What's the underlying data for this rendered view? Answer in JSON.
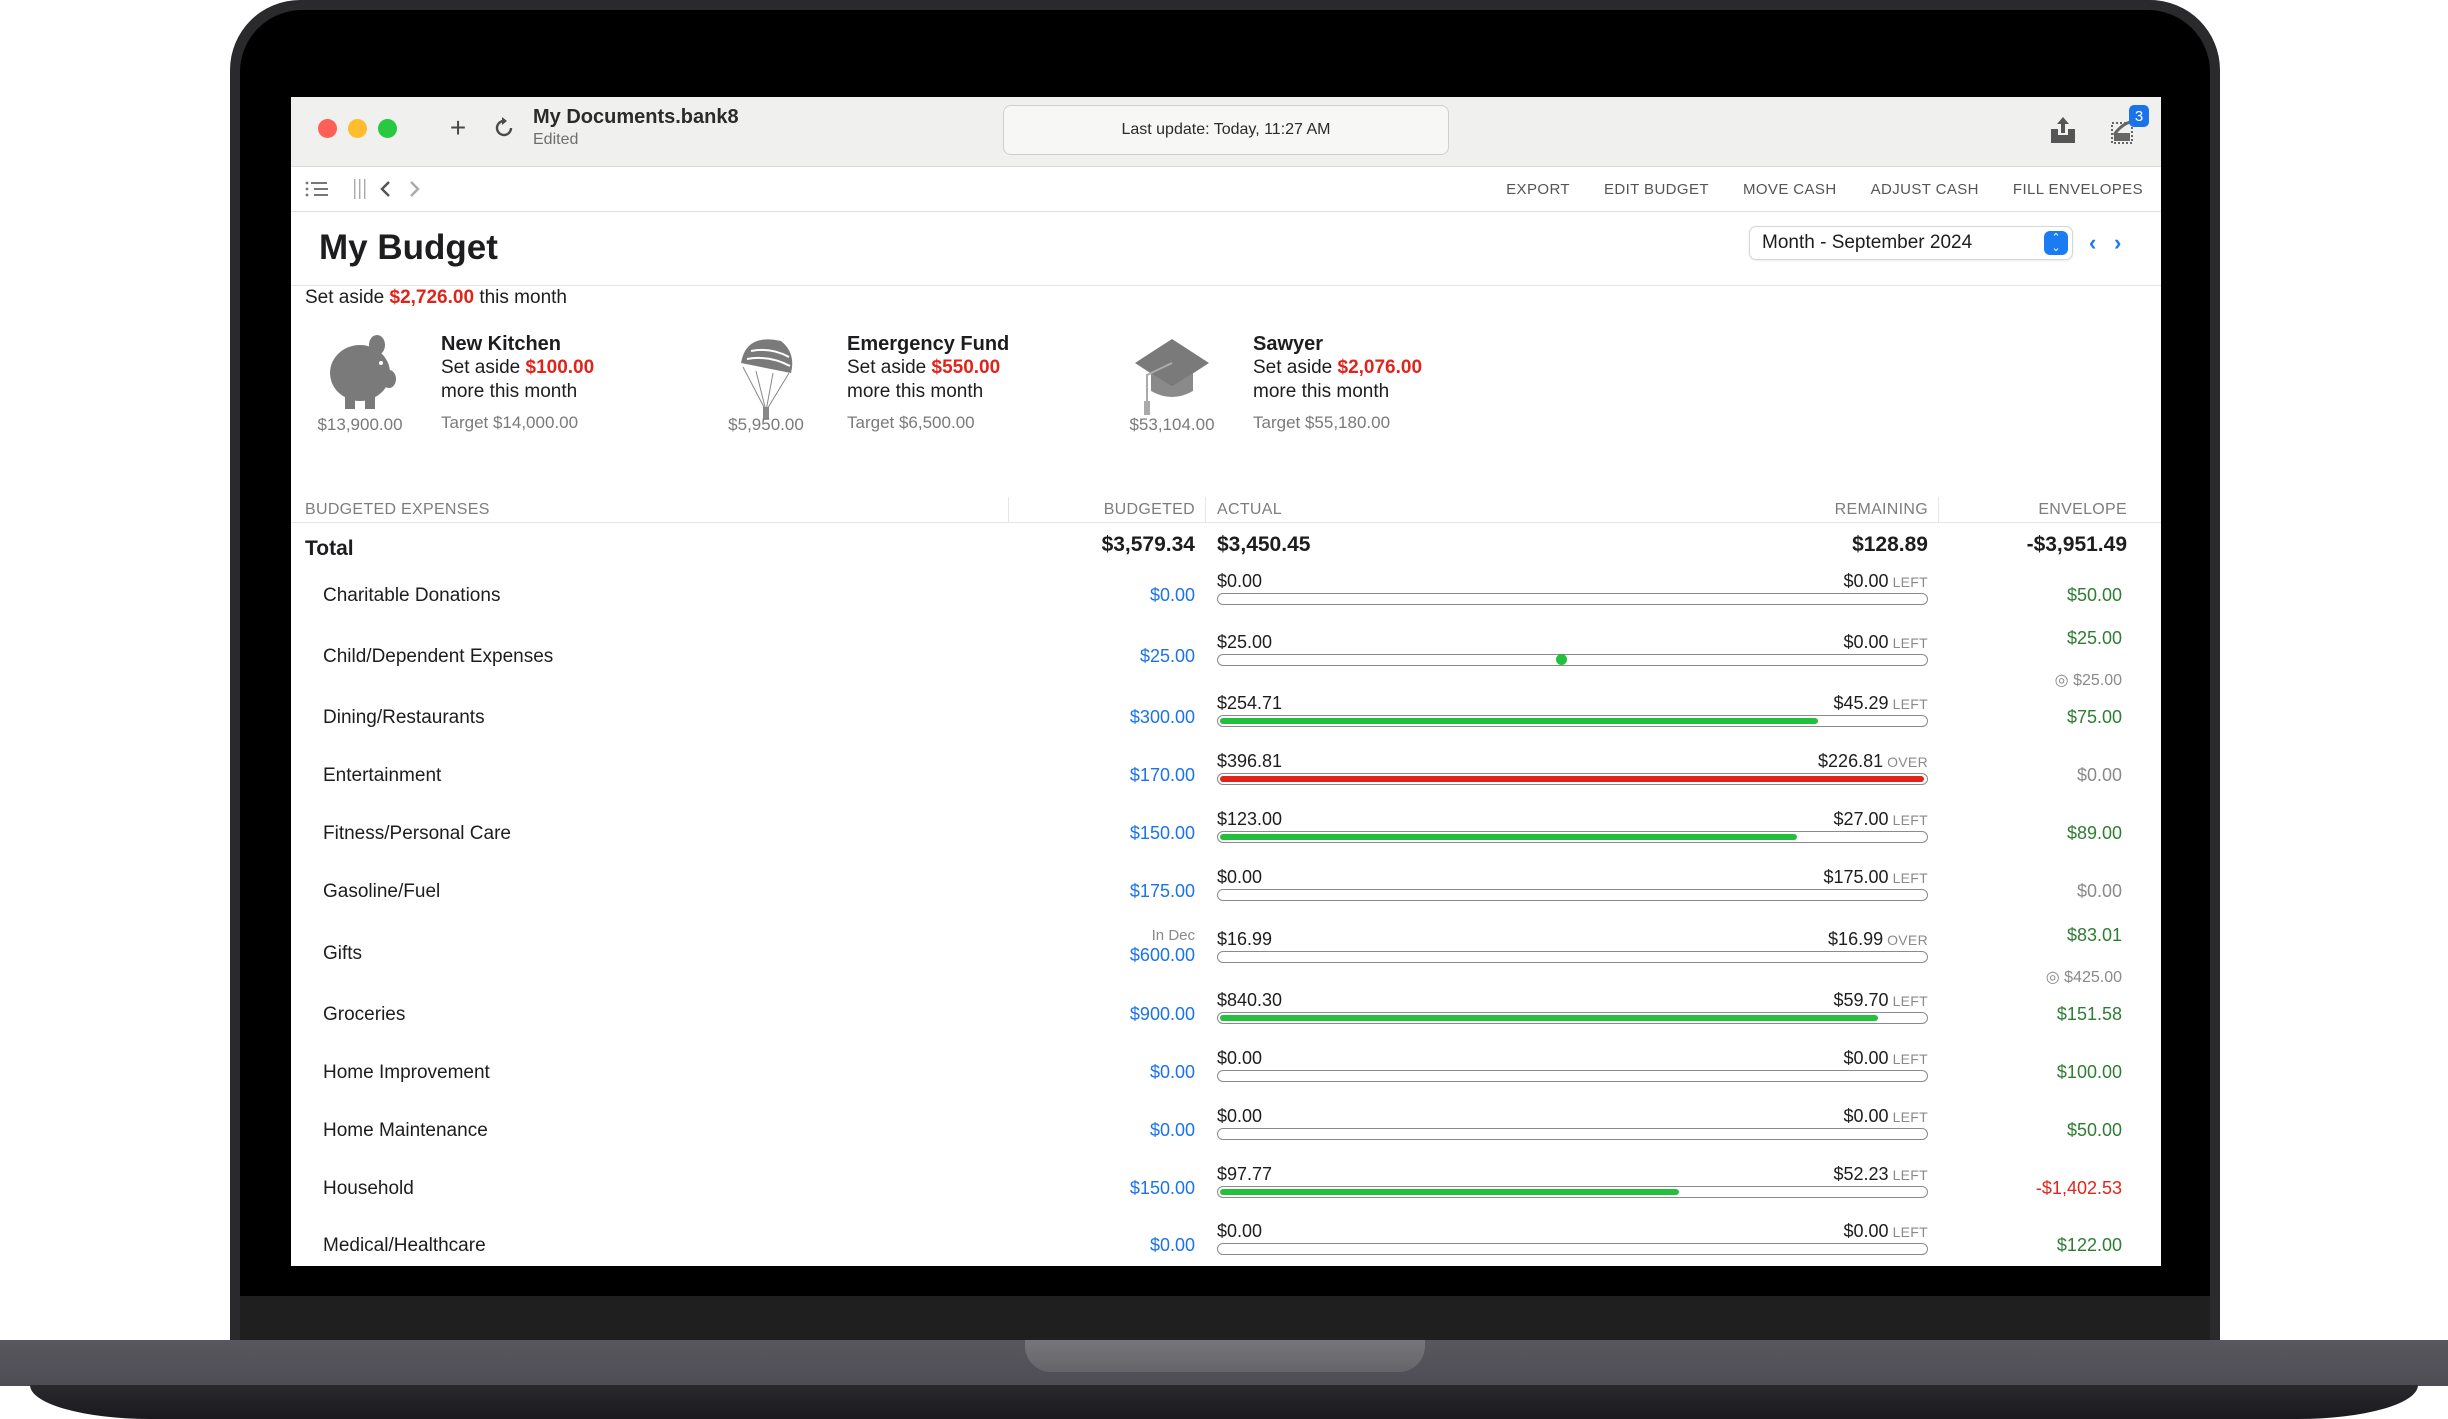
{
  "window": {
    "document_title": "My Documents.bank8",
    "document_status": "Edited",
    "status_message": "Last update: Today, 11:27 AM",
    "notification_count": "3"
  },
  "toolbar": {
    "actions": [
      "EXPORT",
      "EDIT BUDGET",
      "MOVE CASH",
      "ADJUST CASH",
      "FILL ENVELOPES"
    ]
  },
  "page": {
    "title": "My Budget",
    "period": "Month - September 2024",
    "set_aside_prefix": "Set aside",
    "set_aside_amount": "$2,726.00",
    "set_aside_suffix": "this month"
  },
  "goals": [
    {
      "icon": "piggy-bank-icon",
      "name": "New Kitchen",
      "balance": "$13,900.00",
      "set_aside_prefix": "Set aside",
      "set_aside_amount": "$100.00",
      "more": "more this month",
      "target": "Target $14,000.00"
    },
    {
      "icon": "parachute-icon",
      "name": "Emergency Fund",
      "balance": "$5,950.00",
      "set_aside_prefix": "Set aside",
      "set_aside_amount": "$550.00",
      "more": "more this month",
      "target": "Target $6,500.00"
    },
    {
      "icon": "graduation-cap-icon",
      "name": "Sawyer",
      "balance": "$53,104.00",
      "set_aside_prefix": "Set aside",
      "set_aside_amount": "$2,076.00",
      "more": "more this month",
      "target": "Target $55,180.00"
    }
  ],
  "table": {
    "headers": {
      "category": "BUDGETED EXPENSES",
      "budgeted": "BUDGETED",
      "actual": "ACTUAL",
      "remaining": "REMAINING",
      "envelope": "ENVELOPE"
    },
    "total": {
      "label": "Total",
      "budgeted": "$3,579.34",
      "actual": "$3,450.45",
      "remaining": "$128.89",
      "envelope": "-$3,951.49"
    },
    "rows": [
      {
        "name": "Charitable Donations",
        "budgeted": "$0.00",
        "actual": "$0.00",
        "remaining": "$0.00",
        "status": "LEFT",
        "progress": 0,
        "bar": "empty",
        "envelope": "$50.00",
        "envelope_color": "#2e7d32"
      },
      {
        "name": "Child/Dependent Expenses",
        "budgeted": "$25.00",
        "actual": "$25.00",
        "remaining": "$0.00",
        "status": "LEFT",
        "progress": 0.48,
        "bar": "dot",
        "envelope": "$25.00",
        "envelope_color": "#2e7d32",
        "envelope_goal": "◎ $25.00"
      },
      {
        "name": "Dining/Restaurants",
        "budgeted": "$300.00",
        "actual": "$254.71",
        "remaining": "$45.29",
        "status": "LEFT",
        "progress": 0.849,
        "bar": "green",
        "envelope": "$75.00",
        "envelope_color": "#2e7d32"
      },
      {
        "name": "Entertainment",
        "budgeted": "$170.00",
        "actual": "$396.81",
        "remaining": "$226.81",
        "status": "OVER",
        "progress": 1,
        "bar": "red",
        "envelope": "$0.00",
        "envelope_color": "#8a8a8a"
      },
      {
        "name": "Fitness/Personal Care",
        "budgeted": "$150.00",
        "actual": "$123.00",
        "remaining": "$27.00",
        "status": "LEFT",
        "progress": 0.82,
        "bar": "green",
        "envelope": "$89.00",
        "envelope_color": "#2e7d32"
      },
      {
        "name": "Gasoline/Fuel",
        "budgeted": "$175.00",
        "actual": "$0.00",
        "remaining": "$175.00",
        "status": "LEFT",
        "progress": 0,
        "bar": "empty",
        "envelope": "$0.00",
        "envelope_color": "#8a8a8a"
      },
      {
        "name": "Gifts",
        "budgeted_note": "In Dec",
        "budgeted": "$600.00",
        "actual": "$16.99",
        "remaining": "$16.99",
        "status": "OVER",
        "progress": 0,
        "bar": "empty",
        "envelope": "$83.01",
        "envelope_color": "#2e7d32",
        "envelope_goal": "◎ $425.00"
      },
      {
        "name": "Groceries",
        "budgeted": "$900.00",
        "actual": "$840.30",
        "remaining": "$59.70",
        "status": "LEFT",
        "progress": 0.934,
        "bar": "green",
        "envelope": "$151.58",
        "envelope_color": "#2e7d32"
      },
      {
        "name": "Home Improvement",
        "budgeted": "$0.00",
        "actual": "$0.00",
        "remaining": "$0.00",
        "status": "LEFT",
        "progress": 0,
        "bar": "empty",
        "envelope": "$100.00",
        "envelope_color": "#2e7d32"
      },
      {
        "name": "Home Maintenance",
        "budgeted": "$0.00",
        "actual": "$0.00",
        "remaining": "$0.00",
        "status": "LEFT",
        "progress": 0,
        "bar": "empty",
        "envelope": "$50.00",
        "envelope_color": "#2e7d32"
      },
      {
        "name": "Household",
        "budgeted": "$150.00",
        "actual": "$97.77",
        "remaining": "$52.23",
        "status": "LEFT",
        "progress": 0.652,
        "bar": "green",
        "envelope": "-$1,402.53",
        "envelope_color": "#e0241b"
      },
      {
        "name": "Medical/Healthcare",
        "budgeted": "$0.00",
        "actual": "$0.00",
        "remaining": "$0.00",
        "status": "LEFT",
        "progress": 0,
        "bar": "empty",
        "envelope": "$122.00",
        "envelope_color": "#2e7d32"
      }
    ]
  },
  "colors": {
    "accent": "#1a73e8",
    "over": "#e0241b",
    "progress_green": "#22c03c",
    "positive": "#2e7d32"
  }
}
